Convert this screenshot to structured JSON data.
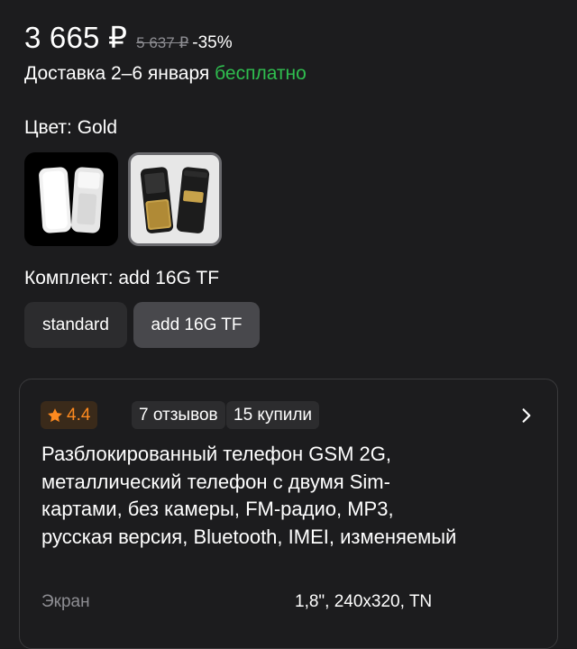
{
  "price": {
    "current": "3 665 ₽",
    "old": "5 637 ₽",
    "discount": "-35%"
  },
  "delivery": {
    "text": "Доставка 2–6 января ",
    "free": "бесплатно"
  },
  "color": {
    "label": "Цвет: Gold",
    "options": [
      "white",
      "gold"
    ],
    "selected": "gold"
  },
  "kit": {
    "label": "Комплект: add 16G TF",
    "options": [
      "standard",
      "add 16G TF"
    ],
    "selected": "add 16G TF"
  },
  "card": {
    "rating": "4.4",
    "reviews": "7 отзывов",
    "bought": "15 купили",
    "title": "Разблокированный телефон GSM 2G, металлический телефон с двумя Sim-картами, без камеры, FM-радио, MP3, русская версия, Bluetooth, IMEI, изменяемый",
    "spec_name": "Экран",
    "spec_value": "1,8\", 240x320, TN"
  },
  "colors": {
    "background": "#1c1c1e",
    "free_green": "#2fbe4f",
    "rating_orange": "#ff8a1f"
  },
  "icons": {
    "rating": "star-icon",
    "more": "chevron-right-icon"
  }
}
